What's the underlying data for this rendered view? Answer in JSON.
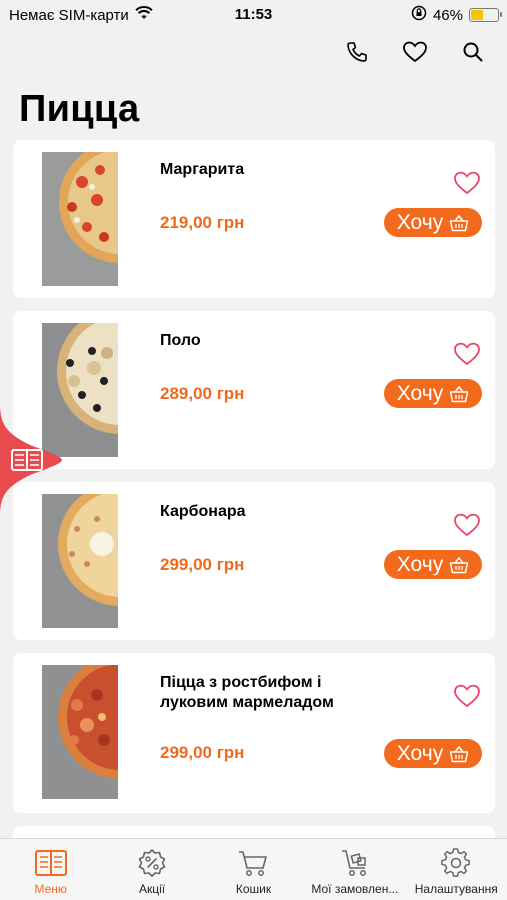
{
  "status_bar": {
    "carrier": "Немає SIM-карти",
    "time": "11:53",
    "battery": "46%",
    "battery_level": 0.46
  },
  "header": {
    "title": "Пицца",
    "icons": [
      "phone-icon",
      "heart-icon",
      "search-icon"
    ]
  },
  "products": [
    {
      "name": "Маргарита",
      "price": "219,00 грн",
      "button": "Хочу"
    },
    {
      "name": "Поло",
      "price": "289,00 грн",
      "button": "Хочу"
    },
    {
      "name": "Карбонара",
      "price": "299,00 грн",
      "button": "Хочу"
    },
    {
      "name": "Піцца з ростбифом і луковим мармеладом",
      "price": "299,00 грн",
      "button": "Хочу"
    }
  ],
  "tab_bar": {
    "tabs": [
      {
        "label": "Меню",
        "icon": "menu-book-icon",
        "active": true
      },
      {
        "label": "Акції",
        "icon": "percent-badge-icon",
        "active": false
      },
      {
        "label": "Кошик",
        "icon": "cart-icon",
        "active": false
      },
      {
        "label": "Мої замовлен...",
        "icon": "delivery-cart-icon",
        "active": false
      },
      {
        "label": "Налаштування",
        "icon": "settings-gear-icon",
        "active": false
      }
    ]
  },
  "colors": {
    "accent": "#f46a1d",
    "heart": "#e8476a",
    "float_tab": "#e84a4e"
  }
}
